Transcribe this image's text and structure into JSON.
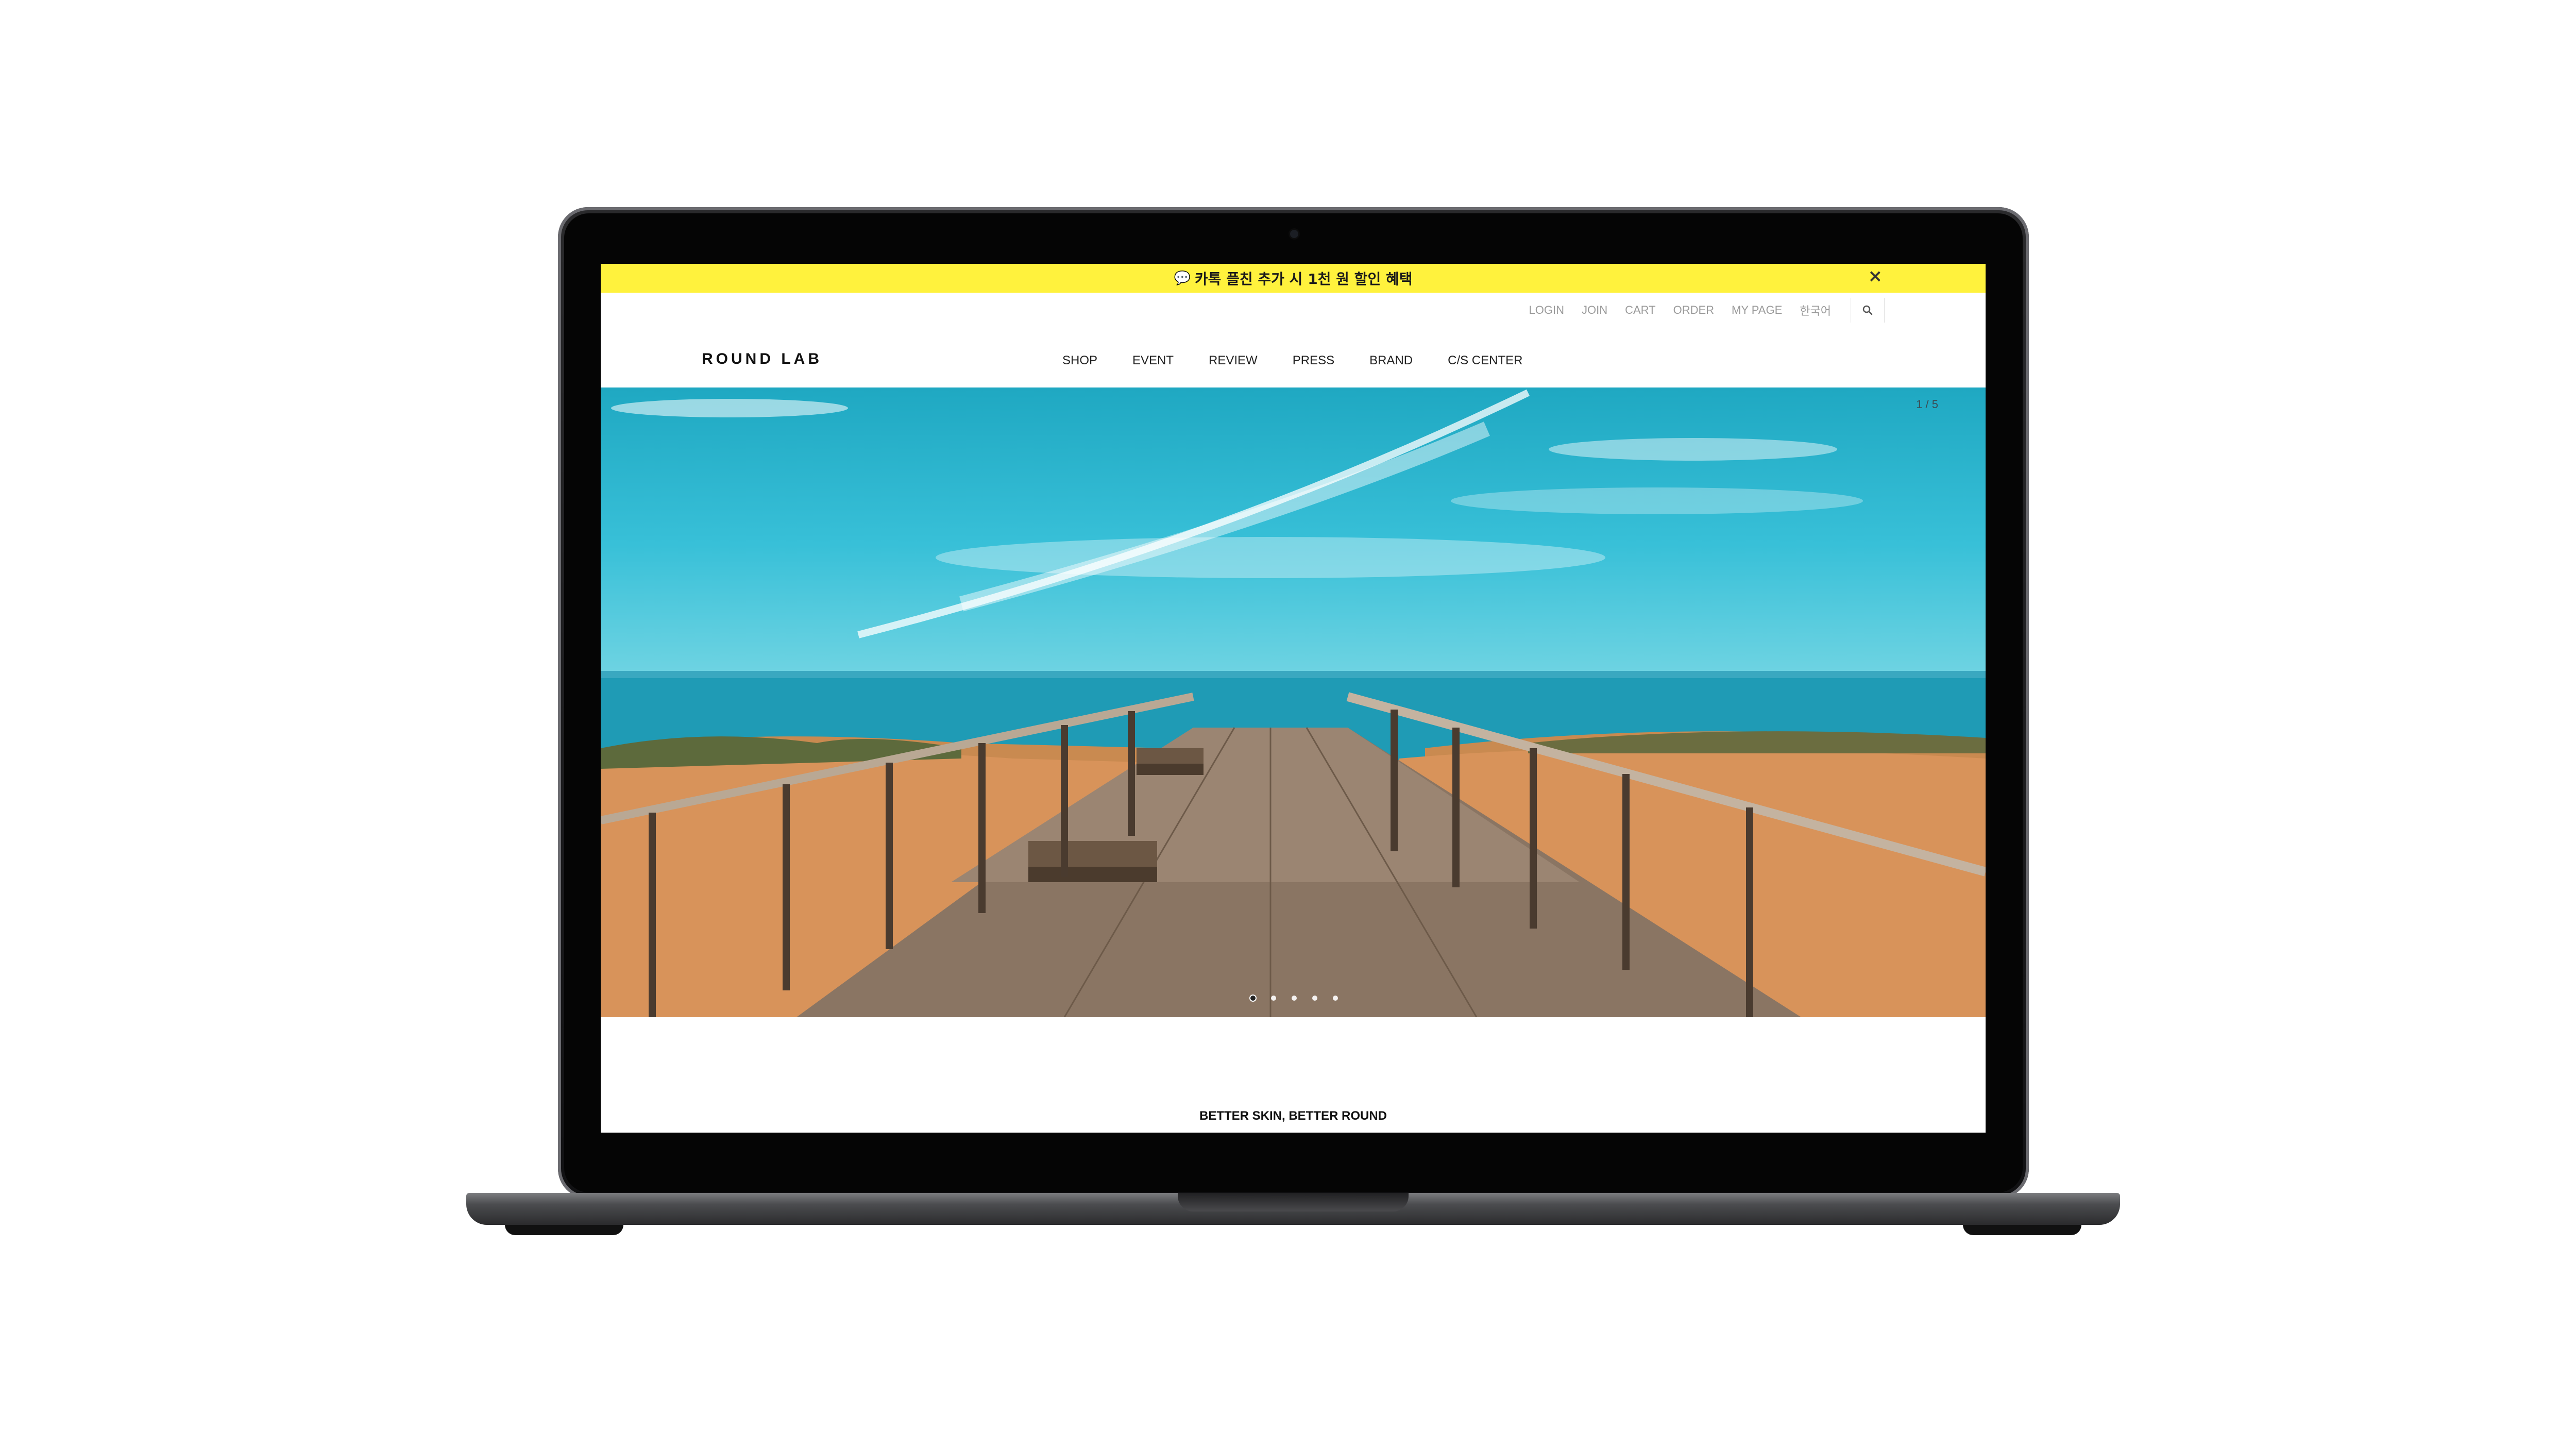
{
  "announcement": {
    "text": "카톡 플친 추가 시 1천 원 할인 혜택",
    "chat_icon": "chat-bubble-icon",
    "close_glyph": "×"
  },
  "utility_nav": {
    "links": [
      "LOGIN",
      "JOIN",
      "CART",
      "ORDER",
      "MY PAGE",
      "한국어"
    ],
    "search_icon": "search-icon"
  },
  "brand": {
    "logo": "ROUND LAB"
  },
  "main_nav": {
    "items": [
      "SHOP",
      "EVENT",
      "REVIEW",
      "PRESS",
      "BRAND",
      "C/S CENTER"
    ]
  },
  "hero": {
    "counter": "1 / 5",
    "slides_total": 5,
    "active_slide": 1
  },
  "content": {
    "tagline": "BETTER SKIN, BETTER ROUND"
  },
  "colors": {
    "announcement_bg": "#fff23d",
    "laptop_body": "#1a1a1c",
    "text": "#111111"
  }
}
